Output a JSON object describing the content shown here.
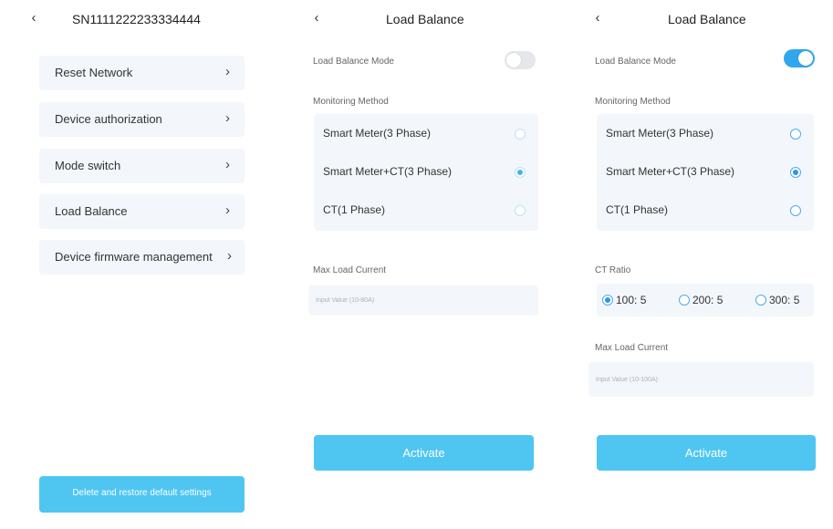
{
  "screen1": {
    "title": "SN1111222233334444",
    "menu": [
      {
        "label": "Reset Network"
      },
      {
        "label": "Device authorization"
      },
      {
        "label": "Mode switch"
      },
      {
        "label": "Load Balance"
      },
      {
        "label": "Device firmware management"
      }
    ],
    "reset_button": "Delete and restore default settings"
  },
  "screen2": {
    "title": "Load Balance",
    "mode_label": "Load Balance Mode",
    "mode_on": false,
    "monitoring_label": "Monitoring Method",
    "options": [
      {
        "label": "Smart Meter(3 Phase)",
        "selected": false
      },
      {
        "label": "Smart Meter+CT(3 Phase)",
        "selected": true
      },
      {
        "label": "CT(1 Phase)",
        "selected": false
      }
    ],
    "max_current_label": "Max Load Current",
    "max_current_placeholder": "Input Value (10-80A)",
    "activate_label": "Activate"
  },
  "screen3": {
    "title": "Load Balance",
    "mode_label": "Load Balance Mode",
    "mode_on": true,
    "monitoring_label": "Monitoring Method",
    "options": [
      {
        "label": "Smart Meter(3 Phase)",
        "selected": false
      },
      {
        "label": "Smart Meter+CT(3 Phase)",
        "selected": true
      },
      {
        "label": "CT(1 Phase)",
        "selected": false
      }
    ],
    "ct_ratio_label": "CT Ratio",
    "ct_ratios": [
      {
        "label": "100: 5",
        "selected": true
      },
      {
        "label": "200: 5",
        "selected": false
      },
      {
        "label": "300: 5",
        "selected": false
      }
    ],
    "max_current_label": "Max Load Current",
    "max_current_placeholder": "Input Value (10-100A)",
    "activate_label": "Activate"
  },
  "icons": {
    "back": "chevron-left-icon",
    "menu_arrow": "chevron-right-icon"
  },
  "colors": {
    "accent": "#4fc6f2",
    "toggle_on": "#2fa7ee",
    "panel_bg": "#f3f6fa"
  }
}
